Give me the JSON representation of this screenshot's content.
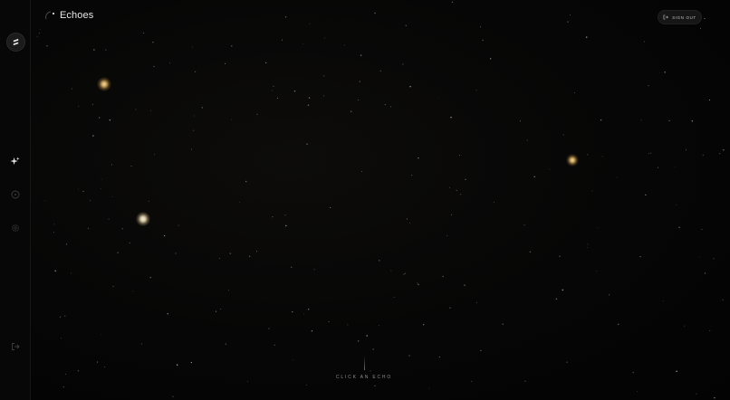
{
  "app": {
    "title": "Echoes"
  },
  "header": {
    "signout_label": "SIGN OUT"
  },
  "sidebar": {
    "items": [
      {
        "icon": "logo-icon"
      },
      {
        "icon": "sparkle-icon",
        "active": true
      },
      {
        "icon": "compass-icon"
      },
      {
        "icon": "settings-icon"
      },
      {
        "icon": "logout-icon"
      }
    ]
  },
  "hint": {
    "label": "CLICK AN ECHO"
  },
  "colors": {
    "background": "#050505",
    "sidebar": "#070707",
    "echo_warm": "#c9a25a",
    "echo_pale": "#d7cba8",
    "text": "#e6e6e6"
  }
}
